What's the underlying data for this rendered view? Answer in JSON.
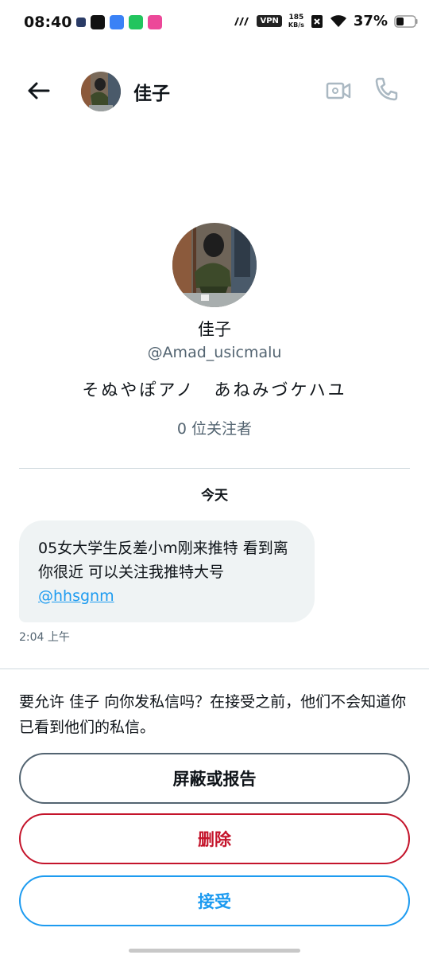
{
  "status_bar": {
    "time": "08:40",
    "vpn": "VPN",
    "speed_value": "185",
    "speed_unit": "KB/s",
    "battery": "37%"
  },
  "header": {
    "name": "佳子"
  },
  "profile": {
    "name": "佳子",
    "handle": "@Amad_usicmalu",
    "bio": "そぬやぽアノ　あねみづケハユ",
    "followers": "0 位关注者"
  },
  "conversation": {
    "date": "今天",
    "message_text": "05女大学生反差小m刚来推特 看到离你很近 可以关注我推特大号 ",
    "message_mention": "@hhsgnm",
    "message_time": "2:04 上午"
  },
  "request": {
    "prompt": "要允许 佳子 向你发私信吗？在接受之前，他们不会知道你已看到他们的私信。",
    "block_label": "屏蔽或报告",
    "delete_label": "删除",
    "accept_label": "接受"
  },
  "colors": {
    "accent": "#1d9bf0",
    "danger": "#c4142b",
    "secondary_text": "#536471"
  }
}
